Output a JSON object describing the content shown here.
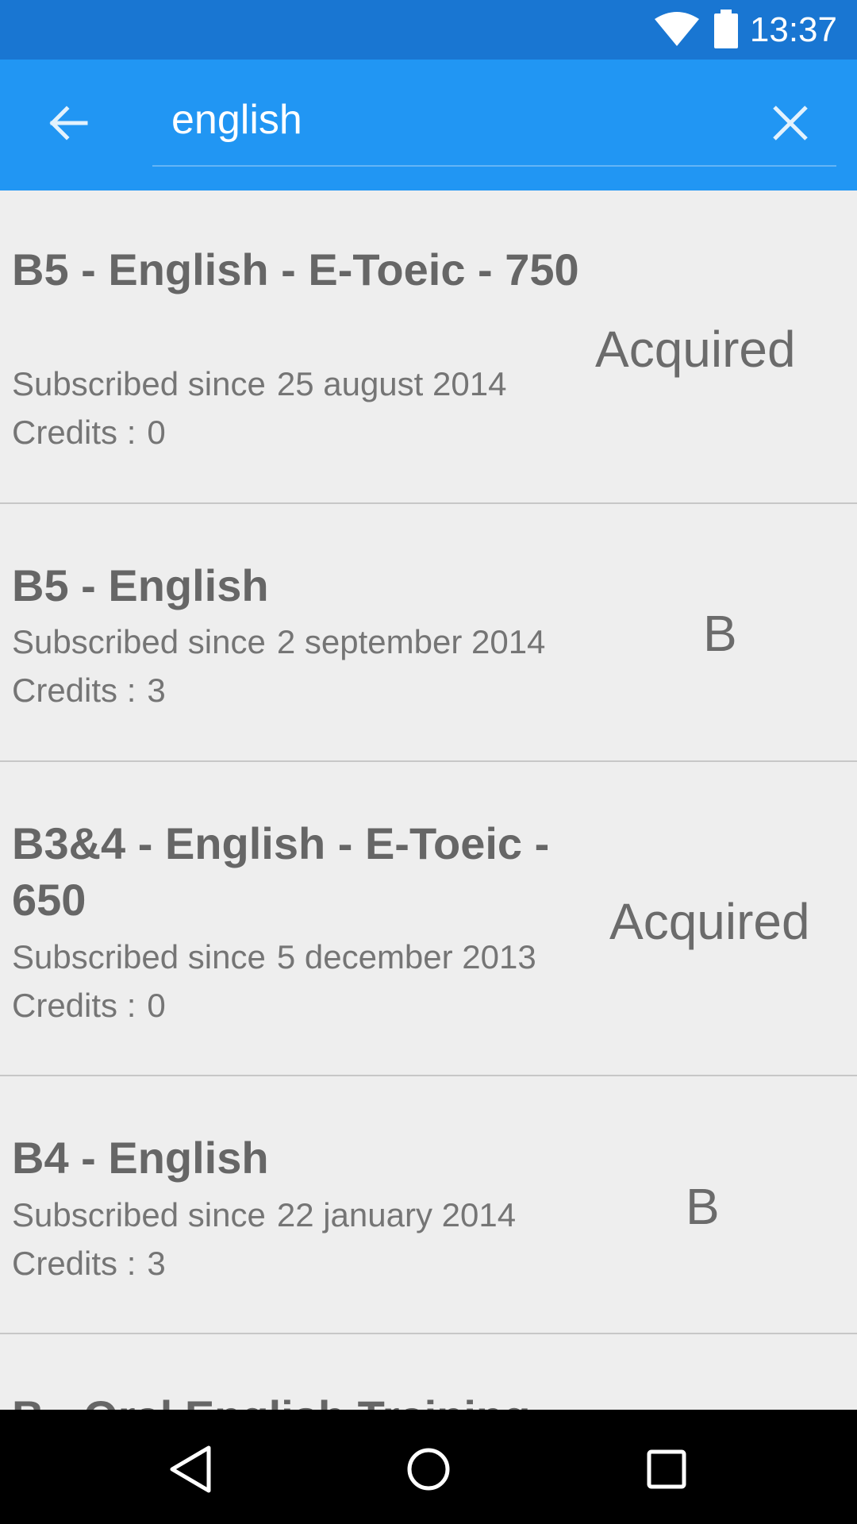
{
  "status_bar": {
    "time": "13:37",
    "icons": [
      "wifi-icon",
      "battery-icon"
    ],
    "color": "#1976d2"
  },
  "search": {
    "value": "english",
    "back_icon": "arrow-left-icon",
    "clear_icon": "close-icon",
    "color": "#2196f3"
  },
  "courses": [
    {
      "title": "B5 - English - E-Toeic - 750",
      "subscribed_label": "Subscribed since",
      "subscribed_date": "25 august 2014",
      "credits_label": "Credits :",
      "credits_value": "0",
      "status": "Acquired"
    },
    {
      "title": "B5 - English",
      "subscribed_label": "Subscribed since",
      "subscribed_date": "2 september 2014",
      "credits_label": "Credits :",
      "credits_value": "3",
      "status": "B"
    },
    {
      "title": "B3&4 - English - E-Toeic - 650",
      "subscribed_label": "Subscribed since",
      "subscribed_date": "5 december 2013",
      "credits_label": "Credits :",
      "credits_value": "0",
      "status": "Acquired"
    },
    {
      "title": "B4 - English",
      "subscribed_label": "Subscribed since",
      "subscribed_date": "22 january 2014",
      "credits_label": "Credits :",
      "credits_value": "3",
      "status": "B"
    },
    {
      "title": "B - Oral English Training"
    }
  ],
  "nav_bar": {
    "icons": [
      "back-triangle-icon",
      "home-circle-icon",
      "recents-square-icon"
    ]
  }
}
